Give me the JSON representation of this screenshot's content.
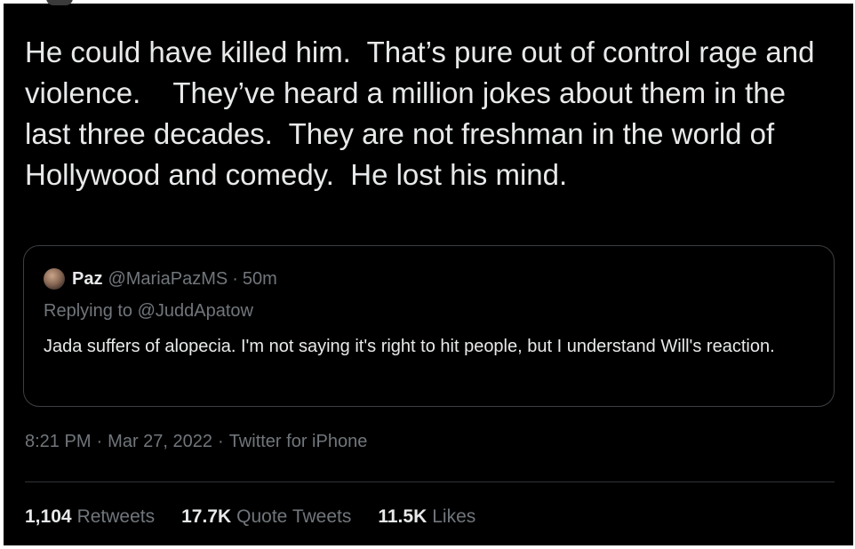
{
  "tweet": {
    "text": "He could have killed him.  That’s pure out of control rage and violence.    They’ve heard a million jokes about them in the last three decades.  They are not freshman in the world of Hollywood and comedy.  He lost his mind.",
    "quoted": {
      "name": "Paz",
      "handle": "@MariaPazMS",
      "separator": "·",
      "time_ago": "50m",
      "replying_to": "Replying to @JuddApatow",
      "text": "Jada suffers of alopecia. I'm not saying it's right to hit people,  but I understand Will's reaction."
    },
    "meta": {
      "time": "8:21 PM",
      "separator": "·",
      "date": "Mar 27, 2022",
      "source": "Twitter for iPhone"
    },
    "stats": [
      {
        "count": "1,104",
        "label": "Retweets"
      },
      {
        "count": "17.7K",
        "label": "Quote Tweets"
      },
      {
        "count": "11.5K",
        "label": "Likes"
      }
    ]
  },
  "colors": {
    "background": "#000000",
    "text_primary": "#e7e9ea",
    "text_secondary": "#71767b",
    "border": "#3c3f42"
  },
  "icons": {
    "quoted_avatar": "avatar-photo"
  }
}
